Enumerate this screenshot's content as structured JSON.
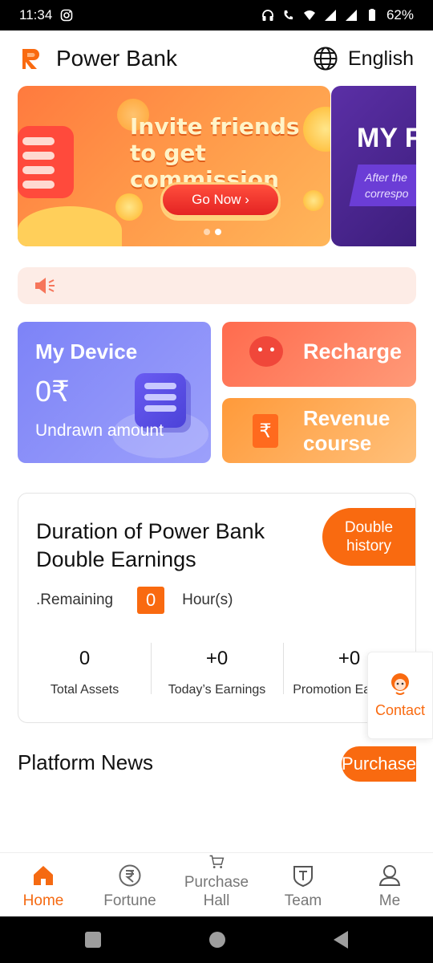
{
  "status_bar": {
    "time": "11:34",
    "battery": "62%"
  },
  "header": {
    "app_title": "Power Bank",
    "language": "English"
  },
  "banner": {
    "slide1_headline": "Invite friends to get commission",
    "slide1_button": "Go Now ›",
    "slide2_title": "MY F",
    "slide2_text": "After the correspo"
  },
  "tiles": {
    "device": {
      "title": "My Device",
      "amount": "0₹",
      "subtitle": "Undrawn amount"
    },
    "recharge": {
      "title": "Recharge"
    },
    "revenue": {
      "title": "Revenue course"
    }
  },
  "earnings_card": {
    "title": "Duration of Power Bank Double Earnings",
    "history_button": "Double history",
    "remaining_label": ".Remaining",
    "remaining_value": "0",
    "remaining_unit": "Hour(s)",
    "stats": [
      {
        "value": "0",
        "label": "Total Assets"
      },
      {
        "value": "+0",
        "label": "Today’s Earnings"
      },
      {
        "value": "+0",
        "label": "Promotion Earnings"
      }
    ]
  },
  "contact": {
    "label": "Contact"
  },
  "news": {
    "title": "Platform News",
    "purchase_button": "Purchase"
  },
  "tabbar": {
    "items": [
      {
        "label": "Home",
        "icon": "home-icon",
        "active": true
      },
      {
        "label": "Fortune",
        "icon": "rupee-icon"
      },
      {
        "label": "Purchase Hall",
        "icon": "cart-icon"
      },
      {
        "label": "Team",
        "icon": "team-icon"
      },
      {
        "label": "Me",
        "icon": "user-icon"
      }
    ]
  },
  "colors": {
    "accent": "#f96a10",
    "device_tile": "#7d83f7",
    "recharge_tile": "#ff6b4e",
    "revenue_tile": "#ff9a3a"
  }
}
